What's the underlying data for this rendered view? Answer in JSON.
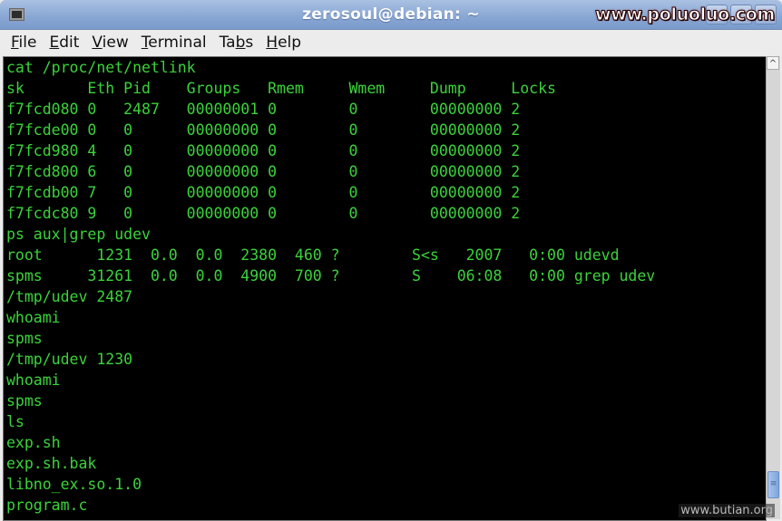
{
  "window": {
    "title": "zerosoul@debian: ~",
    "watermark_top": "www.poluoluo.com",
    "watermark_bottom": "www.butian.org",
    "buttons": {
      "minimize": "_",
      "maximize": "□",
      "close": "✕"
    }
  },
  "menubar": {
    "items": [
      {
        "label": "File",
        "mnemonic": "F",
        "rest": "ile"
      },
      {
        "label": "Edit",
        "mnemonic": "E",
        "rest": "dit"
      },
      {
        "label": "View",
        "mnemonic": "V",
        "rest": "iew"
      },
      {
        "label": "Terminal",
        "mnemonic": "T",
        "rest": "erminal"
      },
      {
        "label": "Tabs",
        "pre": "Ta",
        "mnemonic": "b",
        "rest": "s"
      },
      {
        "label": "Help",
        "mnemonic": "H",
        "rest": "elp"
      }
    ]
  },
  "terminal": {
    "text_color": "#3bd23b",
    "background": "#000000",
    "lines": [
      "cat /proc/net/netlink",
      "sk       Eth Pid    Groups   Rmem     Wmem     Dump     Locks",
      "f7fcd080 0   2487   00000001 0        0        00000000 2",
      "f7fcde00 0   0      00000000 0        0        00000000 2",
      "f7fcd980 4   0      00000000 0        0        00000000 2",
      "f7fcd800 6   0      00000000 0        0        00000000 2",
      "f7fcdb00 7   0      00000000 0        0        00000000 2",
      "f7fcdc80 9   0      00000000 0        0        00000000 2",
      "ps aux|grep udev",
      "root      1231  0.0  0.0  2380  460 ?        S<s   2007   0:00 udevd",
      "spms     31261  0.0  0.0  4900  700 ?        S    06:08   0:00 grep udev",
      "/tmp/udev 2487",
      "whoami",
      "spms",
      "/tmp/udev 1230",
      "whoami",
      "spms",
      "ls",
      "exp.sh",
      "exp.sh.bak",
      "libno_ex.so.1.0",
      "program.c"
    ]
  },
  "scrollbar": {
    "up_arrow": "^",
    "thumb_grip": "≡",
    "position_fraction": 0.95
  }
}
